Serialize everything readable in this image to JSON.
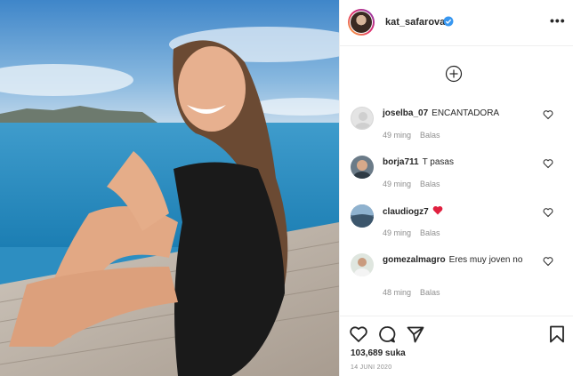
{
  "post": {
    "username": "kat_safarova",
    "likes_text": "103,689 suka",
    "date_text": "14 JUNI 2020"
  },
  "comments": [
    {
      "user": "joselba_07",
      "text": "ENCANTADORA",
      "time": "49 ming",
      "reply": "Balas",
      "emoji": ""
    },
    {
      "user": "borja711",
      "text": "T pasas",
      "time": "49 ming",
      "reply": "Balas",
      "emoji": ""
    },
    {
      "user": "claudiogz7",
      "text": "",
      "time": "49 ming",
      "reply": "Balas",
      "emoji": "red-heart"
    },
    {
      "user": "gomezalmagro",
      "text": "Eres muy joven no",
      "time": "48 ming",
      "reply": "Balas",
      "emoji": ""
    }
  ],
  "icons": {
    "verified": "verified-badge-icon",
    "more": "more-options-icon",
    "load_more": "plus-circle-icon",
    "like": "heart-outline-icon",
    "comment": "comment-bubble-icon",
    "share": "paper-plane-icon",
    "save": "bookmark-icon"
  },
  "colors": {
    "verified_blue": "#3897f0",
    "text": "#262626",
    "muted": "#8e8e8e",
    "heart_red": "#ed4956"
  }
}
